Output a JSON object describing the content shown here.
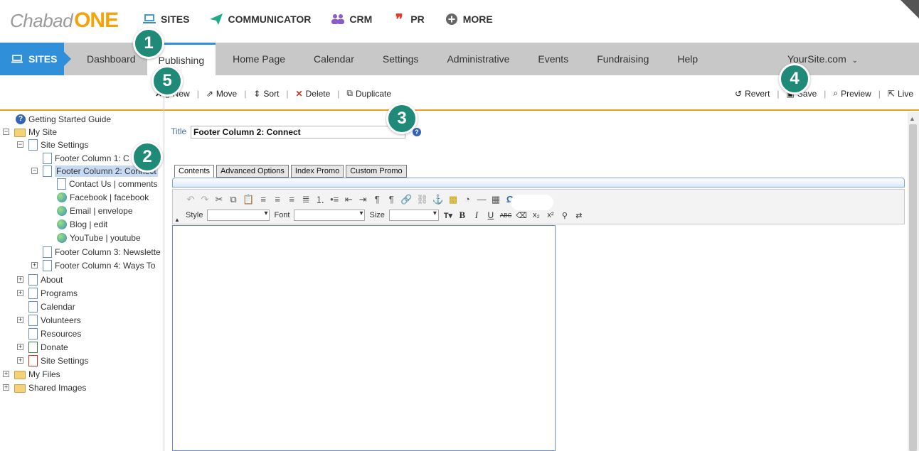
{
  "brand": {
    "chabad": "Chabad",
    "one": "ONE"
  },
  "topnav": [
    {
      "label": "SITES",
      "icon": "laptop-icon",
      "color": "#2f8fd8"
    },
    {
      "label": "COMMUNICATOR",
      "icon": "paper-plane-icon",
      "color": "#1faa88"
    },
    {
      "label": "CRM",
      "icon": "users-icon",
      "color": "#8b5cc9"
    },
    {
      "label": "PR",
      "icon": "quote-icon",
      "color": "#e0392e"
    },
    {
      "label": "MORE",
      "icon": "plus-circle-icon",
      "color": "#555555"
    }
  ],
  "mainnav": {
    "sites": "SITES",
    "tabs": [
      "Dashboard",
      "Publishing",
      "Home Page",
      "Calendar",
      "Settings",
      "Administrative",
      "Events",
      "Fundraising",
      "Help"
    ],
    "active": "Publishing",
    "site": "YourSite.com"
  },
  "toolbar": {
    "left": [
      "New",
      "Move",
      "Sort",
      "Delete",
      "Duplicate"
    ],
    "right": [
      "Revert",
      "Save",
      "Preview",
      "Live"
    ]
  },
  "tree": [
    "Getting Started Guide",
    "My Site",
    "Site Settings",
    "Footer Column 1: C",
    "Footer Column 2: Connect",
    "Contact Us | comments",
    "Facebook | facebook",
    "Email | envelope",
    "Blog | edit",
    "YouTube | youtube",
    "Footer Column 3: Newslette",
    "Footer Column 4: Ways To",
    "About",
    "Programs",
    "Calendar",
    "Volunteers",
    "Resources",
    "Donate",
    "Site Settings",
    "My Files",
    "Shared Images"
  ],
  "editor": {
    "title_label": "Title",
    "title_value": "Footer Column 2: Connect",
    "tabs": [
      "Contents",
      "Advanced Options",
      "Index Promo",
      "Custom Promo"
    ],
    "style_label": "Style",
    "font_label": "Font",
    "size_label": "Size"
  },
  "badges": [
    "1",
    "2",
    "3",
    "4",
    "5"
  ]
}
